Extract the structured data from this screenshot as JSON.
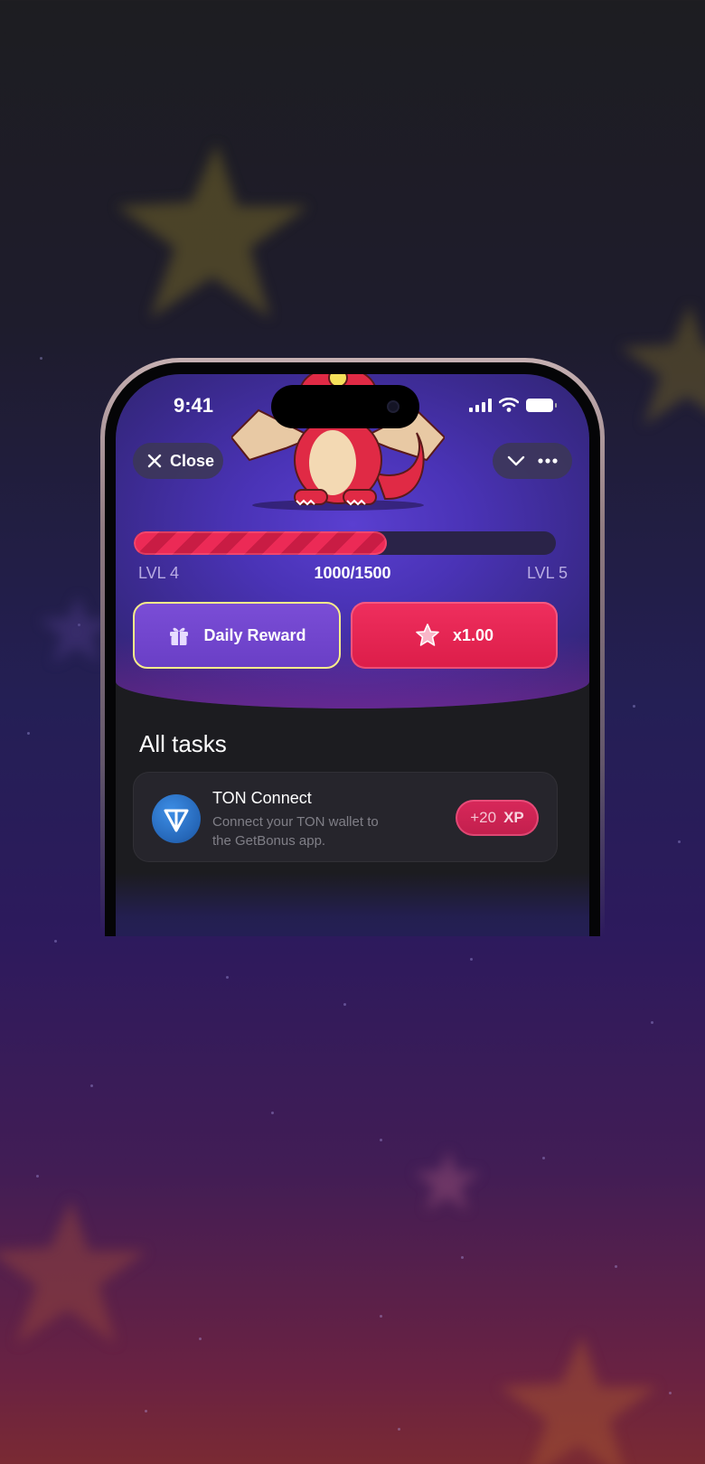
{
  "status_bar": {
    "time": "9:41"
  },
  "header": {
    "close_label": "Close"
  },
  "progress": {
    "current_level": "LVL 4",
    "next_level": "LVL 5",
    "xp_text": "1000/1500",
    "fill_fraction": 0.6
  },
  "actions": {
    "daily_reward_label": "Daily Reward",
    "multiplier_label": "x1.00"
  },
  "tasks": {
    "section_title": "All tasks",
    "items": [
      {
        "title": "TON Connect",
        "description": "Connect your TON wallet to the GetBonus app.",
        "reward_amount": "+20",
        "reward_unit": "XP"
      }
    ]
  },
  "colors": {
    "accent_red": "#e5224f",
    "accent_purple": "#6a3fc6",
    "reward_border": "#f7ec8a",
    "ton_blue": "#2f7ad1"
  },
  "icons": [
    "close-icon",
    "chevron-down-icon",
    "more-icon",
    "gift-icon",
    "star-icon",
    "ton-icon",
    "signal-icon",
    "wifi-icon",
    "battery-icon"
  ]
}
